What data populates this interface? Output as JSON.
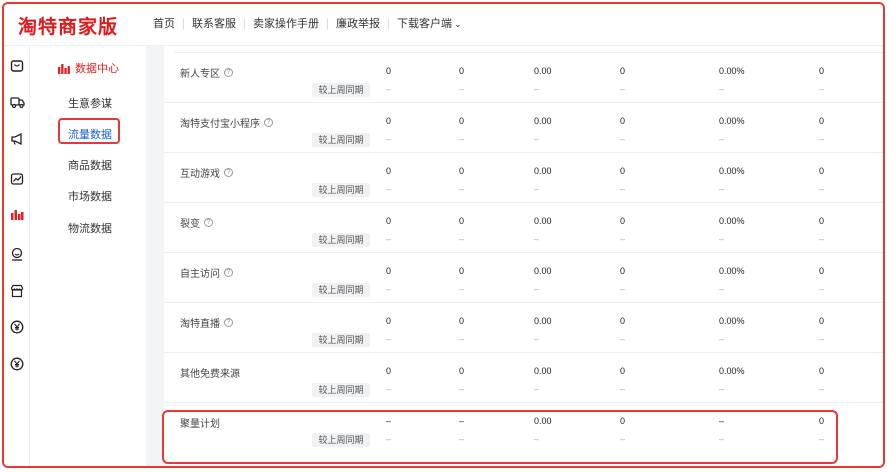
{
  "brand": {
    "logo_text": "淘特商家版"
  },
  "topnav": {
    "items": [
      {
        "label": "首页"
      },
      {
        "label": "联系客服"
      },
      {
        "label": "卖家操作手册"
      },
      {
        "label": "廉政举报"
      },
      {
        "label": "下载客户端"
      }
    ]
  },
  "sidebar": {
    "icons": [
      "shop-bag-icon",
      "truck-icon",
      "megaphone-icon",
      "trend-chart-icon",
      "bar-chart-icon",
      "smile-service-icon",
      "storefront-icon",
      "yen-icon",
      "yen-icon"
    ],
    "active_icon_index": 4,
    "section_title": "数据中心",
    "items": [
      {
        "label": "生意参谋"
      },
      {
        "label": "流量数据"
      },
      {
        "label": "商品数据"
      },
      {
        "label": "市场数据"
      },
      {
        "label": "物流数据"
      }
    ],
    "active_item_index": 1
  },
  "table": {
    "compare_label": "较上周同期",
    "rows": [
      {
        "name": "新人专区",
        "help": true,
        "values": [
          "0",
          "0",
          "0.00",
          "0",
          "0.00%",
          "0"
        ],
        "compare": [
          "–",
          "–",
          "–",
          "–",
          "–",
          "–"
        ]
      },
      {
        "name": "淘特支付宝小程序",
        "help": true,
        "values": [
          "0",
          "0",
          "0.00",
          "0",
          "0.00%",
          "0"
        ],
        "compare": [
          "–",
          "–",
          "–",
          "–",
          "–",
          "–"
        ]
      },
      {
        "name": "互动游戏",
        "help": true,
        "values": [
          "0",
          "0",
          "0.00",
          "0",
          "0.00%",
          "0"
        ],
        "compare": [
          "–",
          "–",
          "–",
          "–",
          "–",
          "–"
        ]
      },
      {
        "name": "裂变",
        "help": true,
        "values": [
          "0",
          "0",
          "0.00",
          "0",
          "0.00%",
          "0"
        ],
        "compare": [
          "–",
          "–",
          "–",
          "–",
          "–",
          "–"
        ]
      },
      {
        "name": "自主访问",
        "help": true,
        "values": [
          "0",
          "0",
          "0.00",
          "0",
          "0.00%",
          "0"
        ],
        "compare": [
          "–",
          "–",
          "–",
          "–",
          "–",
          "–"
        ]
      },
      {
        "name": "淘特直播",
        "help": true,
        "values": [
          "0",
          "0",
          "0.00",
          "0",
          "0.00%",
          "0"
        ],
        "compare": [
          "–",
          "–",
          "–",
          "–",
          "–",
          "–"
        ]
      },
      {
        "name": "其他免费来源",
        "help": false,
        "values": [
          "0",
          "0",
          "0.00",
          "0",
          "0.00%",
          "0"
        ],
        "compare": [
          "–",
          "–",
          "–",
          "–",
          "–",
          "–"
        ]
      },
      {
        "name": "聚量计划",
        "help": false,
        "values": [
          "–",
          "–",
          "0.00",
          "0",
          "–",
          "0"
        ],
        "compare": [
          "–",
          "–",
          "–",
          "–",
          "–",
          "–"
        ]
      }
    ]
  },
  "colors": {
    "brand_red": "#e01a1a",
    "highlight_red": "#e53935",
    "active_blue": "#1a5fd6"
  }
}
